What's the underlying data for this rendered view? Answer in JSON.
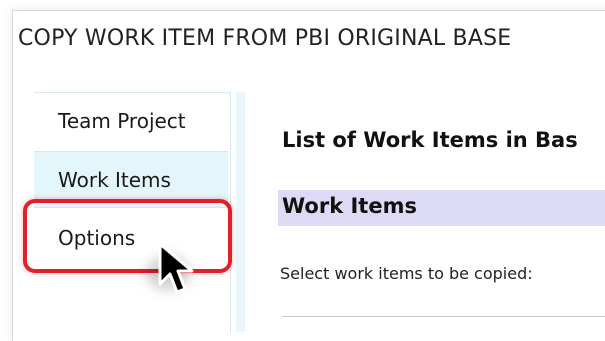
{
  "window": {
    "title": "COPY WORK ITEM FROM PBI ORIGINAL BASE"
  },
  "sidebar": {
    "items": [
      {
        "label": "Team Project"
      },
      {
        "label": "Work Items"
      },
      {
        "label": "Options"
      }
    ],
    "selected": "Work Items",
    "highlighted": "Options"
  },
  "main": {
    "header": "List of Work Items in Bas",
    "section_title": "Work Items",
    "select_label": "Select work items to be copied:"
  },
  "colors": {
    "selected_nav": "#e3f6fb",
    "section_band": "#dcdaf4",
    "highlight_border": "#e12028"
  },
  "icons": {
    "cursor": "mouse-pointer-icon"
  }
}
